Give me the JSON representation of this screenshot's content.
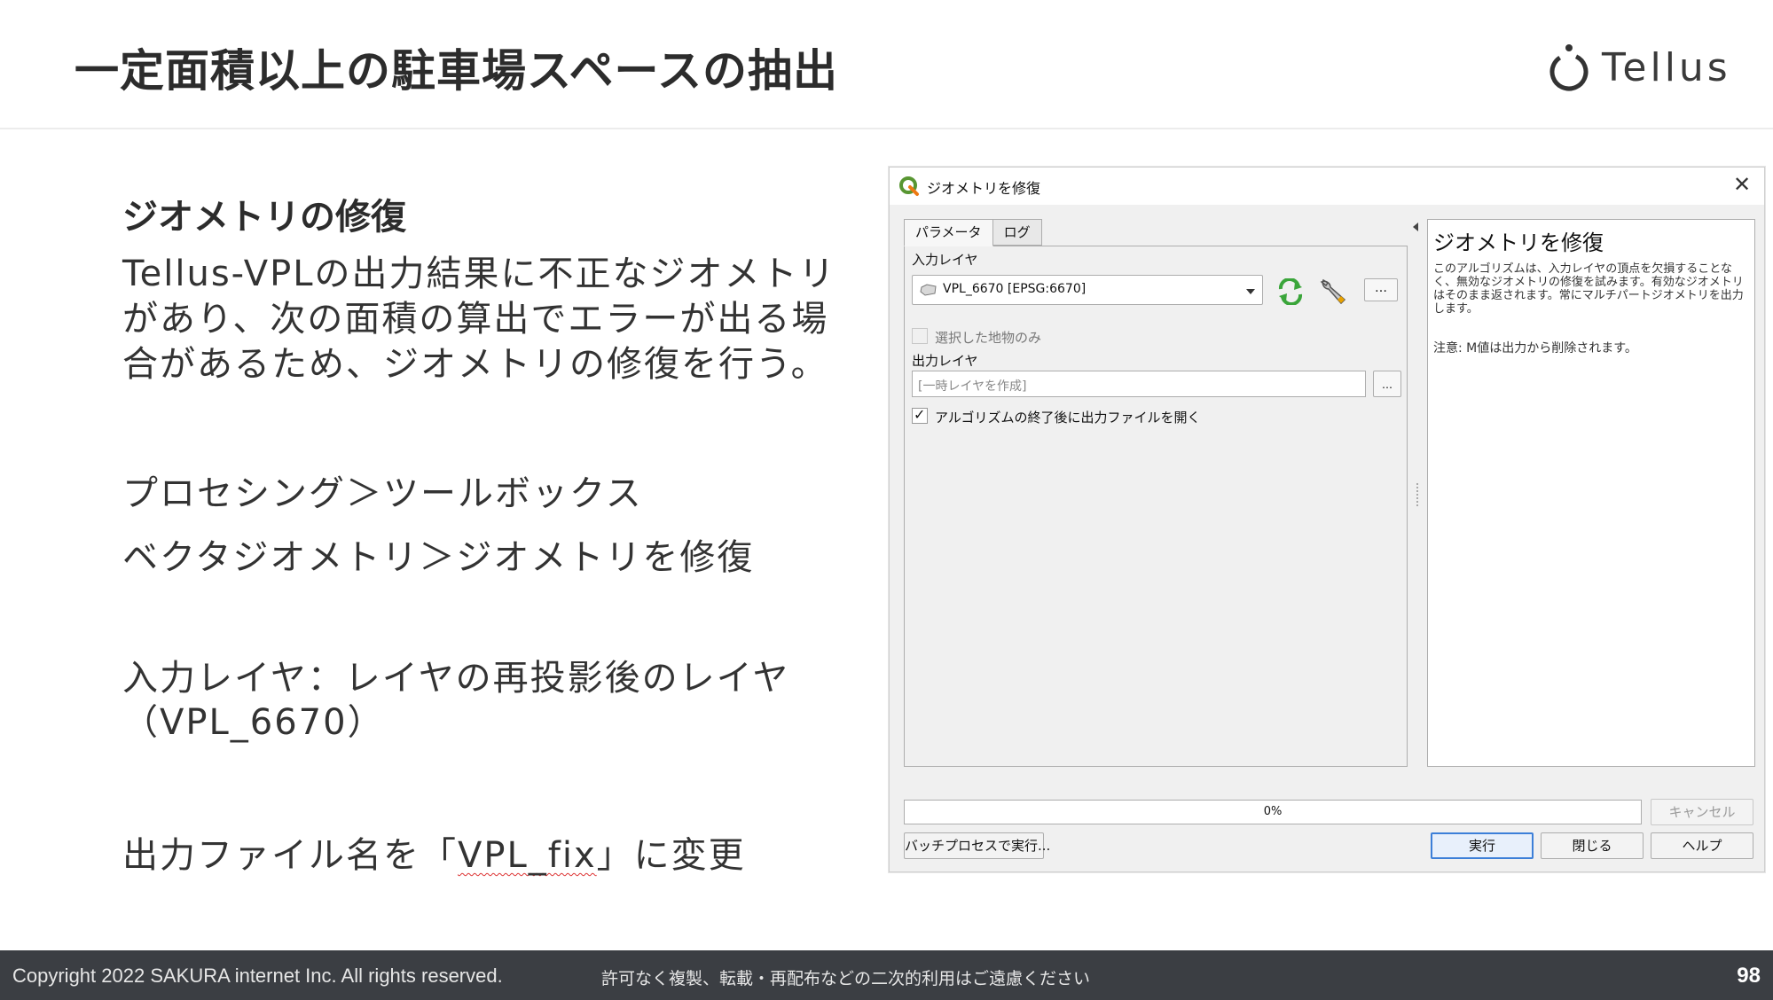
{
  "slide": {
    "title": "一定面積以上の駐車場スペースの抽出",
    "logo_text": "Tellus"
  },
  "content": {
    "heading": "ジオメトリの修復",
    "paragraph": "Tellus-VPLの出力結果に不正なジオメトリがあり、次の面積の算出でエラーが出る場合があるため、ジオメトリの修復を行う。",
    "menu_path_1": "プロセシング＞ツールボックス",
    "menu_path_2": "ベクタジオメトリ＞ジオメトリを修復",
    "input_note": "入力レイヤ：レイヤの再投影後のレイヤ（VPL_6670）",
    "output_note_prefix": "出力ファイル名を「",
    "output_note_name": "VPL_fix",
    "output_note_suffix": "」に変更"
  },
  "dialog": {
    "title": "ジオメトリを修復",
    "tabs": [
      "パラメータ",
      "ログ"
    ],
    "input_layer_label": "入力レイヤ",
    "input_layer_value": "VPL_6670 [EPSG:6670]",
    "more_button": "…",
    "selected_only_label": "選択した地物のみ",
    "output_layer_label": "出力レイヤ",
    "output_layer_placeholder": "[一時レイヤを作成]",
    "output_browse": "…",
    "open_output_label": "アルゴリズムの終了後に出力ファイルを開く",
    "open_output_checked": true,
    "help_title": "ジオメトリを修復",
    "help_body": "このアルゴリズムは、入力レイヤの頂点を欠損することなく、無効なジオメトリの修復を試みます。有効なジオメトリはそのまま返されます。常にマルチパートジオメトリを出力します。",
    "help_note": "注意: M値は出力から削除されます。",
    "progress_percent": 0,
    "progress_text": "0%",
    "cancel_button": "キャンセル",
    "batch_button": "バッチプロセスで実行...",
    "run_button": "実行",
    "close_button": "閉じる",
    "help_button": "ヘルプ"
  },
  "footer": {
    "copyright": "Copyright 2022 SAKURA internet Inc. All rights reserved.",
    "notice": "許可なく複製、転載・再配布などの二次的利用はご遠慮ください",
    "page_number": "98"
  },
  "colors": {
    "footer_bg": "#3b3e43",
    "dialog_bg": "#f0f0f0",
    "qgis_green": "#589632",
    "default_button_border": "#3c7fd8"
  }
}
